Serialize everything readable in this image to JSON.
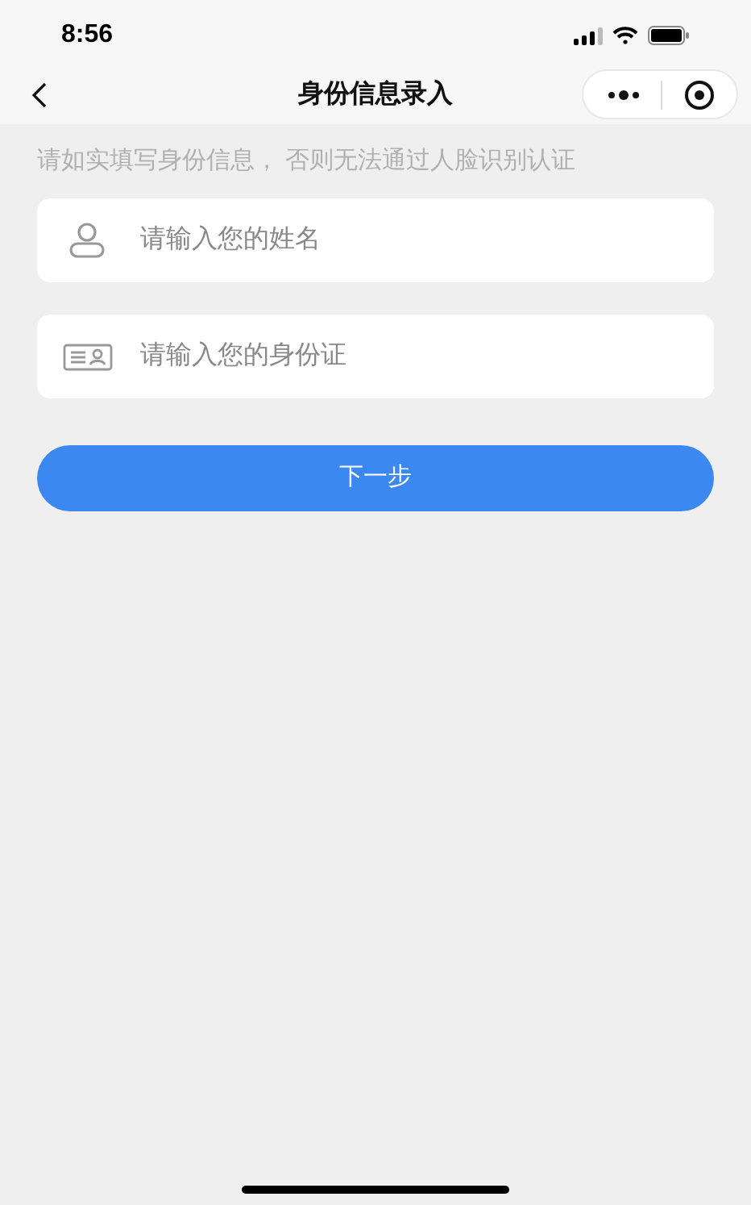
{
  "status_bar": {
    "time": "8:56"
  },
  "nav": {
    "title": "身份信息录入"
  },
  "hint": "请如实填写身份信息， 否则无法通过人脸识别认证",
  "fields": [
    {
      "kind": "person",
      "placeholder": "请输入您的姓名"
    },
    {
      "kind": "id-card",
      "placeholder": "请输入您的身份证"
    }
  ],
  "button": "下一步"
}
